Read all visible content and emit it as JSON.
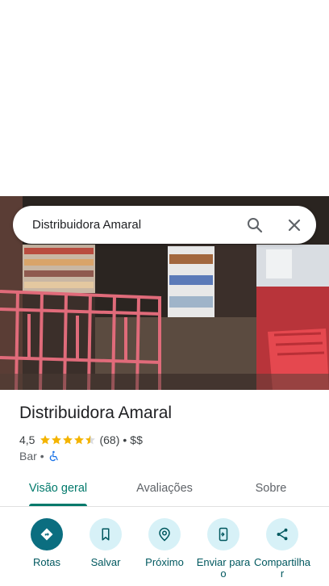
{
  "search": {
    "query": "Distribuidora Amaral"
  },
  "place": {
    "title": "Distribuidora Amaral",
    "rating": "4,5",
    "rating_value": 4.5,
    "review_count": "(68)",
    "separator": "•",
    "price": "$$",
    "category": "Bar",
    "accessibility_icon": "wheelchair-icon"
  },
  "tabs": [
    {
      "label": "Visão geral",
      "active": true
    },
    {
      "label": "Avaliações",
      "active": false
    },
    {
      "label": "Sobre",
      "active": false
    }
  ],
  "actions": [
    {
      "label": "Rotas",
      "icon": "directions-icon"
    },
    {
      "label": "Salvar",
      "icon": "bookmark-icon"
    },
    {
      "label": "Próximo",
      "icon": "nearby-icon"
    },
    {
      "label": "Enviar para o",
      "icon": "send-to-phone-icon"
    },
    {
      "label": "Compartilhar",
      "icon": "share-icon"
    }
  ],
  "colors": {
    "accent": "#00796b",
    "action_bg": "#d7f1f7",
    "primary_action": "#0b6e80",
    "star": "#f4b400"
  }
}
